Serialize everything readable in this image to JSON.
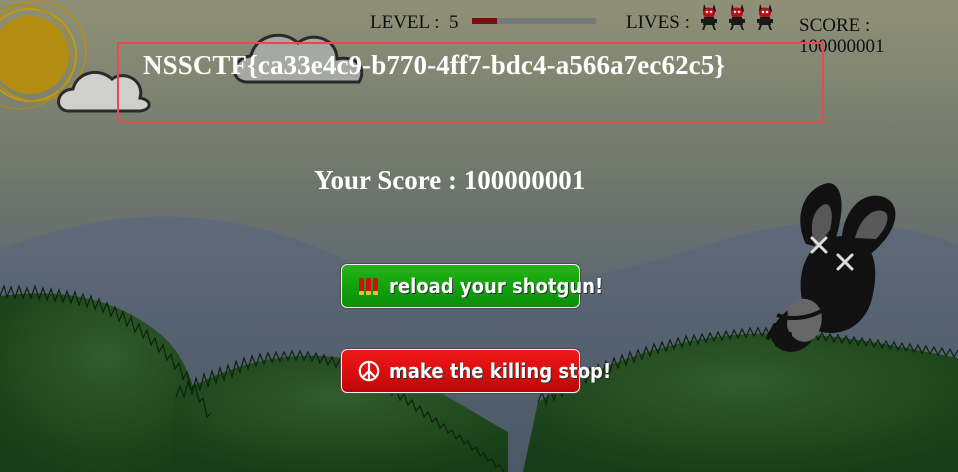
{
  "hud": {
    "level_label": "LEVEL :",
    "level_value": "5",
    "level_progress": 0.2,
    "lives_label": "LIVES :",
    "lives_count": 3,
    "score_label": "SCORE :",
    "score_value": "100000001"
  },
  "result": {
    "flag_text": "NSSCTF{ca33e4c9-b770-4ff7-bdc4-a566a7ec62c5}",
    "your_score_text": "Your Score : 100000001"
  },
  "buttons": {
    "reload_label": "reload your shotgun!",
    "stop_label": "make the killing stop!",
    "reload_icon": "shotgun-shells-icon",
    "stop_icon": "peace-sign-icon"
  },
  "icons": {
    "life_icon": "rabbit-life-icon",
    "sun_icon": "sun-icon",
    "cloud_icon": "cloud-icon",
    "rabbit_icon": "dead-rabbit-icon"
  },
  "colors": {
    "flag_outline": "#e64b4f",
    "level_fill": "#7a0d10",
    "reload_button": "#14a50e",
    "stop_button": "#d90d0d",
    "life_icon": "#b01018"
  }
}
